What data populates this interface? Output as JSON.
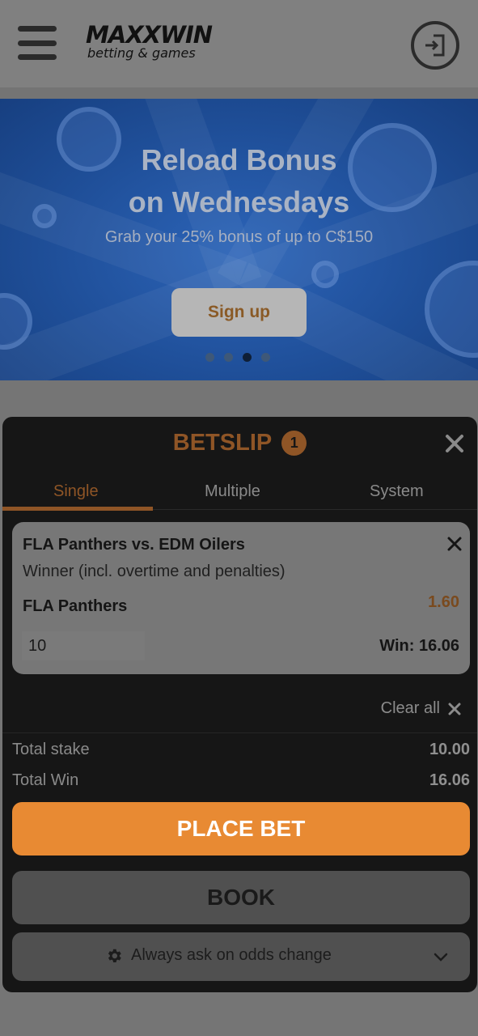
{
  "header": {
    "logo_main": "MAXXWIN",
    "logo_sub": "betting & games",
    "menu_icon": "hamburger-icon",
    "login_icon": "login-door-icon"
  },
  "banner": {
    "title_line1": "Reload Bonus",
    "title_line2": "on Wednesdays",
    "subtitle": "Grab your 25% bonus of up to C$150",
    "cta": "Sign up",
    "slides": 4,
    "active_slide": 3
  },
  "betslip": {
    "title": "BETSLIP",
    "count": "1",
    "tabs": [
      {
        "label": "Single",
        "active": true
      },
      {
        "label": "Multiple",
        "active": false
      },
      {
        "label": "System",
        "active": false
      }
    ],
    "bet": {
      "match": "FLA Panthers vs. EDM Oilers",
      "market": "Winner (incl. overtime and penalties)",
      "pick": "FLA Panthers",
      "odds": "1.60",
      "stake": "10",
      "win": "Win: 16.06"
    },
    "clear_all": "Clear all",
    "total_stake_label": "Total stake",
    "total_stake_value": "10.00",
    "total_win_label": "Total Win",
    "total_win_value": "16.06",
    "place_bet": "PLACE BET",
    "book": "BOOK",
    "odds_change": "Always ask on odds change"
  },
  "colors": {
    "accent": "#e88a33",
    "overlay_dark": "#161616"
  }
}
